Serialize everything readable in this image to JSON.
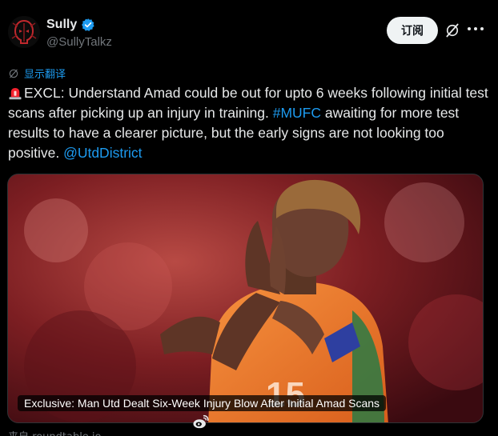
{
  "author": {
    "display_name": "Sully",
    "handle": "@SullyTalkz",
    "verified": true,
    "avatar_icon": "spider-skull-logo-icon"
  },
  "actions": {
    "subscribe_label": "订阅",
    "grok_icon": "grok-icon",
    "more_icon": "more-dots-icon"
  },
  "translate": {
    "label": "显示翻译",
    "icon": "translate-icon"
  },
  "tweet": {
    "emoji": "siren-icon",
    "text_1": "EXCL: Understand Amad could be out for upto 6 weeks following initial test scans after picking up an injury in training. ",
    "hashtag": "#MUFC",
    "text_2": " awaiting for more test results to have a clearer picture, but the early signs are not looking too positive. ",
    "mention": "@UtdDistrict"
  },
  "card": {
    "title": "Exclusive: Man Utd Dealt Six-Week Injury Blow After Initial Amad Scans",
    "source": "来自 roundtable.io"
  },
  "colors": {
    "accent": "#1d9bf0",
    "background": "#000000",
    "text": "#e7e9ea",
    "muted": "#71767b",
    "jersey": "#f07a2a"
  }
}
